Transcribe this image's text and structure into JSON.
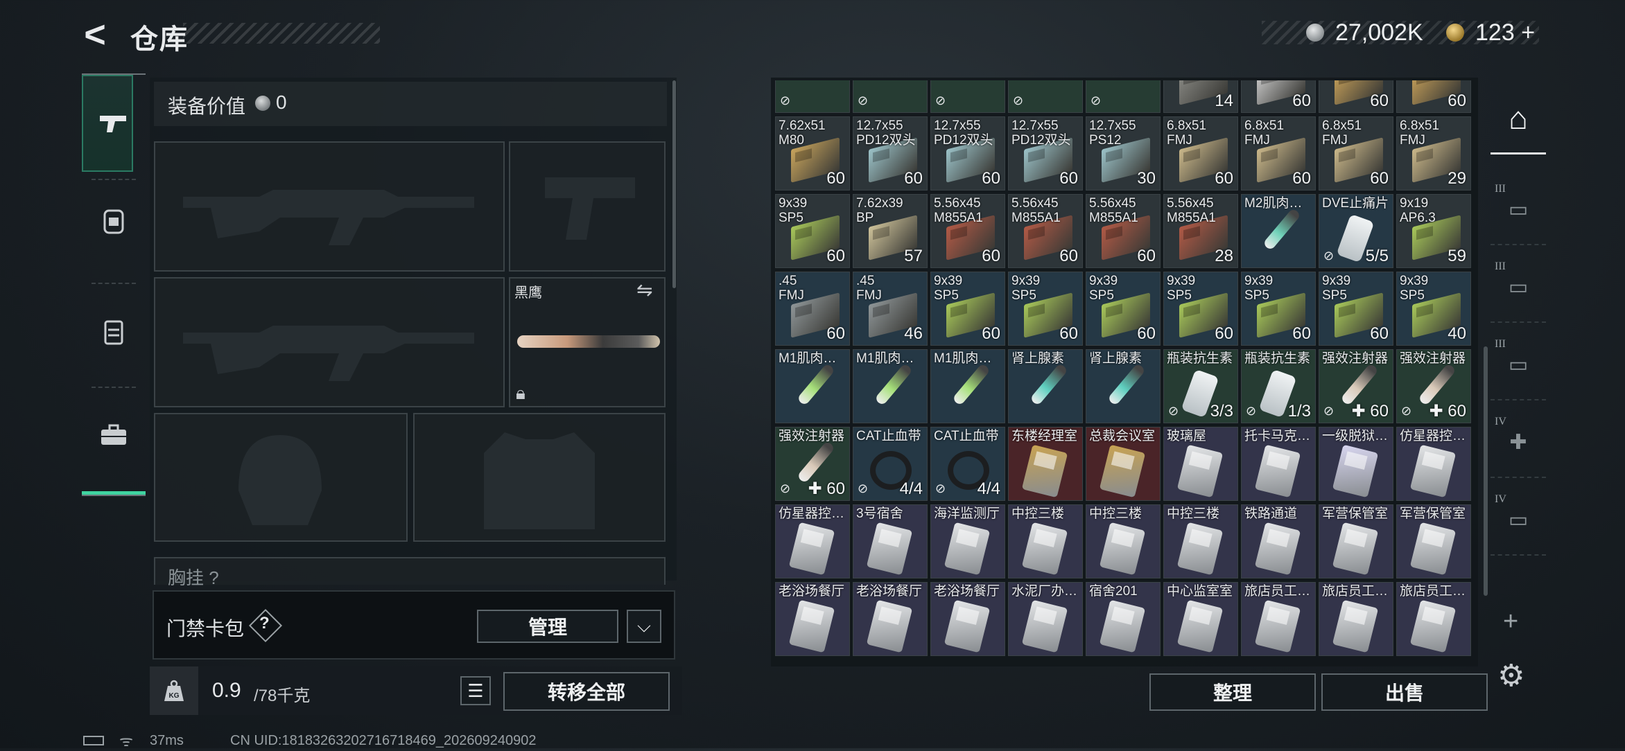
{
  "header": {
    "back_icon": "back-arrow-icon",
    "title": "仓库"
  },
  "currency": {
    "silver": "27,002K",
    "gold": "123",
    "gold_plus": "+"
  },
  "equipment": {
    "value_label": "装备价值",
    "value": "0",
    "melee_name": "黑鹰",
    "chest_label": "胸挂",
    "chest_help": "?"
  },
  "access_card": {
    "label": "门禁卡包",
    "help": "?",
    "manage": "管理",
    "dropdown": "⌵"
  },
  "weight": {
    "current": "0.9",
    "capacity": "/78千克",
    "icon": "kg"
  },
  "actions": {
    "list_icon": "☰",
    "transfer_all": "转移全部",
    "sort": "整理",
    "sell": "出售"
  },
  "status": {
    "ping": "37ms",
    "uid": "CN UID:1818326320271671​8469_202609240902"
  },
  "storage": {
    "rows": [
      [
        {
          "name": "",
          "qty": "",
          "bg": "green",
          "icon": "none",
          "flag": "⊘"
        },
        {
          "name": "",
          "qty": "",
          "bg": "green",
          "icon": "none",
          "flag": "⊘"
        },
        {
          "name": "",
          "qty": "",
          "bg": "green",
          "icon": "none",
          "flag": "⊘"
        },
        {
          "name": "",
          "qty": "",
          "bg": "green",
          "icon": "none",
          "flag": "⊘"
        },
        {
          "name": "",
          "qty": "",
          "bg": "green",
          "icon": "none",
          "flag": "⊘"
        },
        {
          "name": "",
          "qty": "14",
          "bg": "gray",
          "icon": "box",
          "color": "#8b8b86"
        },
        {
          "name": "",
          "qty": "60",
          "bg": "gray",
          "icon": "box",
          "color": "#cfcfcf"
        },
        {
          "name": "",
          "qty": "60",
          "bg": "gray",
          "icon": "box",
          "color": "#c9a25a"
        },
        {
          "name": "",
          "qty": "60",
          "bg": "gray",
          "icon": "box",
          "color": "#c9a25a"
        }
      ],
      [
        {
          "name": "7.62x51\nM80",
          "qty": "60",
          "bg": "gray",
          "icon": "box",
          "color": "#c8a45c"
        },
        {
          "name": "12.7x55\nPD12双头",
          "qty": "60",
          "bg": "gray",
          "icon": "box",
          "color": "#9cc3c9"
        },
        {
          "name": "12.7x55\nPD12双头",
          "qty": "60",
          "bg": "gray",
          "icon": "box",
          "color": "#9cc3c9"
        },
        {
          "name": "12.7x55\nPD12双头",
          "qty": "60",
          "bg": "gray",
          "icon": "box",
          "color": "#9cc3c9"
        },
        {
          "name": "12.7x55\nPS12",
          "qty": "30",
          "bg": "gray",
          "icon": "box",
          "color": "#9cc3c9"
        },
        {
          "name": "6.8x51\nFMJ",
          "qty": "60",
          "bg": "gray",
          "icon": "box",
          "color": "#cbb88a"
        },
        {
          "name": "6.8x51\nFMJ",
          "qty": "60",
          "bg": "gray",
          "icon": "box",
          "color": "#cbb88a"
        },
        {
          "name": "6.8x51\nFMJ",
          "qty": "60",
          "bg": "gray",
          "icon": "box",
          "color": "#cbb88a"
        },
        {
          "name": "6.8x51\nFMJ",
          "qty": "29",
          "bg": "gray",
          "icon": "box",
          "color": "#cbb88a"
        }
      ],
      [
        {
          "name": "9x39\nSP5",
          "qty": "60",
          "bg": "gray",
          "icon": "box",
          "color": "#a9c95a"
        },
        {
          "name": "7.62x39\nBP",
          "qty": "57",
          "bg": "gray",
          "icon": "box",
          "color": "#cfc39a"
        },
        {
          "name": "5.56x45\nM855A1",
          "qty": "60",
          "bg": "gray",
          "icon": "box",
          "color": "#b25a46"
        },
        {
          "name": "5.56x45\nM855A1",
          "qty": "60",
          "bg": "gray",
          "icon": "box",
          "color": "#b25a46"
        },
        {
          "name": "5.56x45\nM855A1",
          "qty": "60",
          "bg": "gray",
          "icon": "box",
          "color": "#b25a46"
        },
        {
          "name": "5.56x45\nM855A1",
          "qty": "28",
          "bg": "gray",
          "icon": "box",
          "color": "#b25a46"
        },
        {
          "name": "M2肌肉…",
          "qty": "",
          "bg": "blue",
          "icon": "syringe",
          "color": "#6fd1b8"
        },
        {
          "name": "DVE止痛片",
          "qty": "5/5",
          "bg": "blue",
          "icon": "bottle",
          "flag": "⊘"
        },
        {
          "name": "9x19\nAP6.3",
          "qty": "59",
          "bg": "gray",
          "icon": "box",
          "color": "#a9c95a"
        }
      ],
      [
        {
          "name": ".45\nFMJ",
          "qty": "60",
          "bg": "blue",
          "icon": "box",
          "color": "#8f9698"
        },
        {
          "name": ".45\nFMJ",
          "qty": "46",
          "bg": "blue",
          "icon": "box",
          "color": "#8f9698"
        },
        {
          "name": "9x39\nSP5",
          "qty": "60",
          "bg": "blue",
          "icon": "box",
          "color": "#a9c95a"
        },
        {
          "name": "9x39\nSP5",
          "qty": "60",
          "bg": "blue",
          "icon": "box",
          "color": "#a9c95a"
        },
        {
          "name": "9x39\nSP5",
          "qty": "60",
          "bg": "blue",
          "icon": "box",
          "color": "#a9c95a"
        },
        {
          "name": "9x39\nSP5",
          "qty": "60",
          "bg": "blue",
          "icon": "box",
          "color": "#a9c95a"
        },
        {
          "name": "9x39\nSP5",
          "qty": "60",
          "bg": "blue",
          "icon": "box",
          "color": "#a9c95a"
        },
        {
          "name": "9x39\nSP5",
          "qty": "60",
          "bg": "blue",
          "icon": "box",
          "color": "#a9c95a"
        },
        {
          "name": "9x39\nSP5",
          "qty": "40",
          "bg": "blue",
          "icon": "box",
          "color": "#a9c95a"
        }
      ],
      [
        {
          "name": "M1肌肉…",
          "qty": "",
          "bg": "blue",
          "icon": "syringe",
          "color": "#a6e07a"
        },
        {
          "name": "M1肌肉…",
          "qty": "",
          "bg": "blue",
          "icon": "syringe",
          "color": "#a6e07a"
        },
        {
          "name": "M1肌肉…",
          "qty": "",
          "bg": "blue",
          "icon": "syringe",
          "color": "#a6e07a"
        },
        {
          "name": "肾上腺素",
          "qty": "",
          "bg": "blue",
          "icon": "syringe",
          "color": "#5fd0c0"
        },
        {
          "name": "肾上腺素",
          "qty": "",
          "bg": "blue",
          "icon": "syringe",
          "color": "#5fd0c0"
        },
        {
          "name": "瓶装抗生素",
          "qty": "3/3",
          "bg": "green",
          "icon": "bottle",
          "flag": "⊘"
        },
        {
          "name": "瓶装抗生素",
          "qty": "1/3",
          "bg": "green",
          "icon": "bottle",
          "flag": "⊘"
        },
        {
          "name": "强效注射器",
          "qty": "✚ 60",
          "bg": "green",
          "icon": "syringe",
          "color": "#d9c9b8",
          "flag": "⊘"
        },
        {
          "name": "强效注射器",
          "qty": "✚ 60",
          "bg": "green",
          "icon": "syringe",
          "color": "#d9c9b8",
          "flag": "⊘"
        }
      ],
      [
        {
          "name": "强效注射器",
          "qty": "✚ 60",
          "bg": "green",
          "icon": "syringe",
          "color": "#d9c9b8",
          "flag": "⊘"
        },
        {
          "name": "CAT止血带",
          "qty": "4/4",
          "bg": "blue",
          "icon": "tourniquet",
          "flag": "⊘"
        },
        {
          "name": "CAT止血带",
          "qty": "4/4",
          "bg": "blue",
          "icon": "tourniquet",
          "flag": "⊘"
        },
        {
          "name": "东楼经理室",
          "qty": "",
          "bg": "red",
          "icon": "keycard",
          "color": "#c9a352"
        },
        {
          "name": "总裁会议室",
          "qty": "",
          "bg": "red",
          "icon": "keycard",
          "color": "#c9a352"
        },
        {
          "name": "玻璃屋",
          "qty": "",
          "bg": "purple",
          "icon": "keycard",
          "color": "#e4e6e8"
        },
        {
          "name": "托卡马克…",
          "qty": "",
          "bg": "purple",
          "icon": "keycard",
          "color": "#e4e6e8"
        },
        {
          "name": "一级脱狱…",
          "qty": "",
          "bg": "purple",
          "icon": "keycard",
          "color": "#d8d6f0"
        },
        {
          "name": "仿星器控…",
          "qty": "",
          "bg": "purple",
          "icon": "keycard",
          "color": "#e4e6e8"
        }
      ],
      [
        {
          "name": "仿星器控…",
          "qty": "",
          "bg": "purple",
          "icon": "keycard",
          "color": "#e4e6e8"
        },
        {
          "name": "3号宿舍",
          "qty": "",
          "bg": "purple",
          "icon": "keycard",
          "color": "#e4e6e8"
        },
        {
          "name": "海洋监测厅",
          "qty": "",
          "bg": "purple",
          "icon": "keycard",
          "color": "#e4e6e8"
        },
        {
          "name": "中控三楼",
          "qty": "",
          "bg": "purple",
          "icon": "keycard",
          "color": "#e4e6e8"
        },
        {
          "name": "中控三楼",
          "qty": "",
          "bg": "purple",
          "icon": "keycard",
          "color": "#e4e6e8"
        },
        {
          "name": "中控三楼",
          "qty": "",
          "bg": "purple",
          "icon": "keycard",
          "color": "#e4e6e8"
        },
        {
          "name": "铁路通道",
          "qty": "",
          "bg": "purple",
          "icon": "keycard",
          "color": "#e4e6e8"
        },
        {
          "name": "军营保管室",
          "qty": "",
          "bg": "purple",
          "icon": "keycard",
          "color": "#e4e6e8"
        },
        {
          "name": "军营保管室",
          "qty": "",
          "bg": "purple",
          "icon": "keycard",
          "color": "#e4e6e8"
        }
      ],
      [
        {
          "name": "老浴场餐厅",
          "qty": "",
          "bg": "purple",
          "icon": "keycard",
          "color": "#e4e6e8"
        },
        {
          "name": "老浴场餐厅",
          "qty": "",
          "bg": "purple",
          "icon": "keycard",
          "color": "#e4e6e8"
        },
        {
          "name": "老浴场餐厅",
          "qty": "",
          "bg": "purple",
          "icon": "keycard",
          "color": "#e4e6e8"
        },
        {
          "name": "水泥厂办…",
          "qty": "",
          "bg": "purple",
          "icon": "keycard",
          "color": "#e4e6e8"
        },
        {
          "name": "宿舍201",
          "qty": "",
          "bg": "purple",
          "icon": "keycard",
          "color": "#e4e6e8"
        },
        {
          "name": "中心监室室",
          "qty": "",
          "bg": "purple",
          "icon": "keycard",
          "color": "#e4e6e8"
        },
        {
          "name": "旅店员工…",
          "qty": "",
          "bg": "purple",
          "icon": "keycard",
          "color": "#e4e6e8"
        },
        {
          "name": "旅店员工…",
          "qty": "",
          "bg": "purple",
          "icon": "keycard",
          "color": "#e4e6e8"
        },
        {
          "name": "旅店员工…",
          "qty": "",
          "bg": "purple",
          "icon": "keycard",
          "color": "#e4e6e8"
        }
      ]
    ]
  },
  "left_rail": [
    {
      "icon": "pistol-icon",
      "glyph": "⌐╦"
    },
    {
      "icon": "backpack-icon",
      "glyph": "⛑"
    },
    {
      "icon": "vest-icon",
      "glyph": "▤"
    },
    {
      "icon": "briefcase-icon",
      "glyph": "💼"
    }
  ],
  "right_rail": [
    {
      "icon": "storage-icon",
      "glyph": "⌂",
      "tier": ""
    },
    {
      "icon": "weapon-crate-icon",
      "glyph": "▭",
      "tier": "III"
    },
    {
      "icon": "ammo-crate-icon",
      "glyph": "▭",
      "tier": "III"
    },
    {
      "icon": "supply-crate-icon",
      "glyph": "▭",
      "tier": "III"
    },
    {
      "icon": "medical-crate-icon",
      "glyph": "✚",
      "tier": "IV"
    },
    {
      "icon": "doc-crate-icon",
      "glyph": "▭",
      "tier": "IV"
    }
  ],
  "right_extra": {
    "add": "+",
    "settings": "⚙"
  }
}
